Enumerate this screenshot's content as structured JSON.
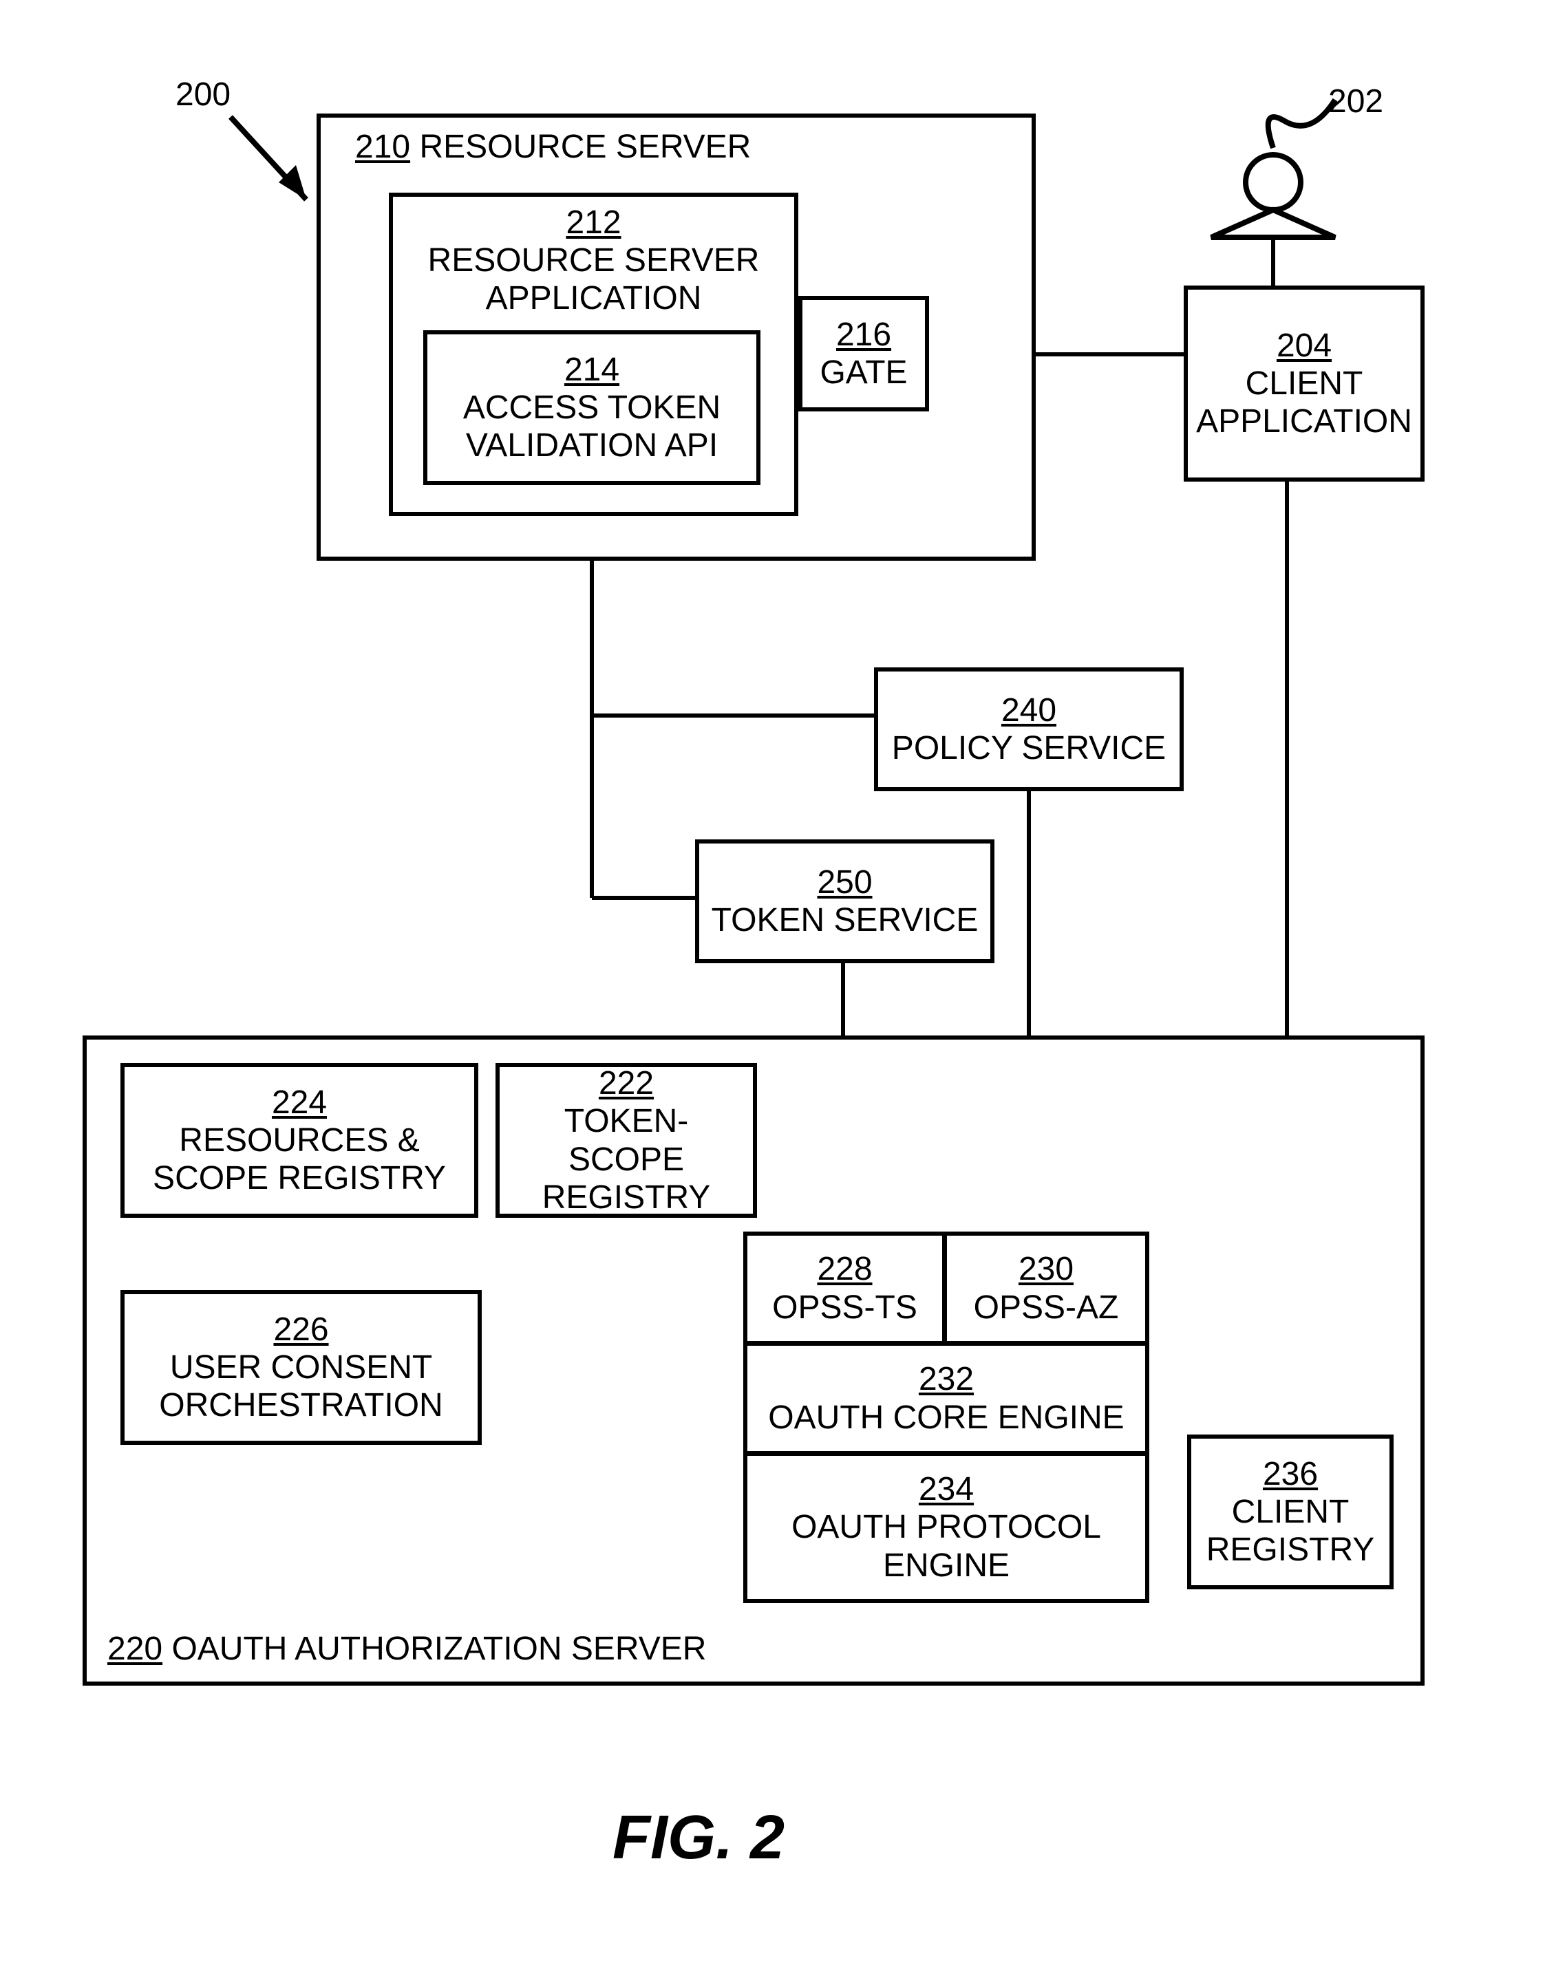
{
  "figure": {
    "number_label": "200",
    "user_label": "202",
    "caption": "FIG. 2"
  },
  "resource_server": {
    "ref": "210",
    "title": "RESOURCE SERVER",
    "app": {
      "ref": "212",
      "title": "RESOURCE SERVER APPLICATION"
    },
    "validation": {
      "ref": "214",
      "title": "ACCESS TOKEN VALIDATION API"
    },
    "gate": {
      "ref": "216",
      "title": "GATE"
    }
  },
  "client_app": {
    "ref": "204",
    "title": "CLIENT APPLICATION"
  },
  "policy_service": {
    "ref": "240",
    "title": "POLICY SERVICE"
  },
  "token_service": {
    "ref": "250",
    "title": "TOKEN SERVICE"
  },
  "oauth_server": {
    "ref": "220",
    "title": "OAUTH AUTHORIZATION SERVER",
    "res_scope": {
      "ref": "224",
      "title": "RESOURCES & SCOPE REGISTRY"
    },
    "token_scope": {
      "ref": "222",
      "title": "TOKEN-SCOPE REGISTRY"
    },
    "consent": {
      "ref": "226",
      "title": "USER CONSENT ORCHESTRATION"
    },
    "opss_ts": {
      "ref": "228",
      "title": "OPSS-TS"
    },
    "opss_az": {
      "ref": "230",
      "title": "OPSS-AZ"
    },
    "core_engine": {
      "ref": "232",
      "title": "OAUTH CORE ENGINE"
    },
    "protocol_engine": {
      "ref": "234",
      "title": "OAUTH PROTOCOL ENGINE"
    },
    "client_registry": {
      "ref": "236",
      "title": "CLIENT REGISTRY"
    }
  }
}
